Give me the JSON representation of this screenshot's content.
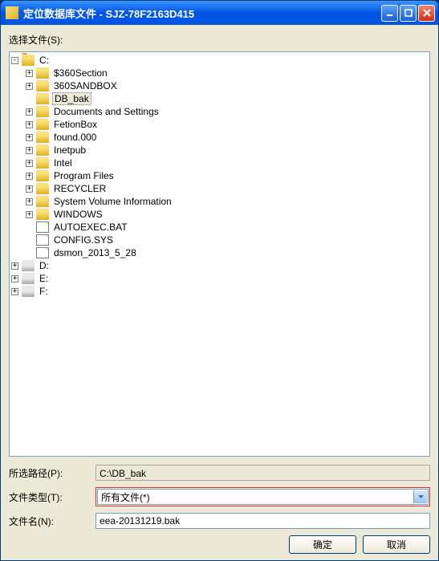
{
  "titlebar": {
    "title": "定位数据库文件 - SJZ-78F2163D415"
  },
  "labels": {
    "select_file": "选择文件(S):",
    "selected_path": "所选路径(P):",
    "file_type": "文件类型(T):",
    "file_name": "文件名(N):"
  },
  "tree": {
    "root_c": "C:",
    "items_c": [
      {
        "label": "$360Section",
        "exp": "plus",
        "icon": "folder"
      },
      {
        "label": "360SANDBOX",
        "exp": "plus",
        "icon": "folder"
      },
      {
        "label": "DB_bak",
        "exp": "none",
        "icon": "folder",
        "selected": true
      },
      {
        "label": "Documents and Settings",
        "exp": "plus",
        "icon": "folder"
      },
      {
        "label": "FetionBox",
        "exp": "plus",
        "icon": "folder"
      },
      {
        "label": "found.000",
        "exp": "plus",
        "icon": "folder"
      },
      {
        "label": "Inetpub",
        "exp": "plus",
        "icon": "folder"
      },
      {
        "label": "Intel",
        "exp": "plus",
        "icon": "folder"
      },
      {
        "label": "Program Files",
        "exp": "plus",
        "icon": "folder"
      },
      {
        "label": "RECYCLER",
        "exp": "plus",
        "icon": "folder"
      },
      {
        "label": "System Volume Information",
        "exp": "plus",
        "icon": "folder"
      },
      {
        "label": "WINDOWS",
        "exp": "plus",
        "icon": "folder"
      },
      {
        "label": "AUTOEXEC.BAT",
        "exp": "none",
        "icon": "file"
      },
      {
        "label": "CONFIG.SYS",
        "exp": "none",
        "icon": "file"
      },
      {
        "label": "dsmon_2013_5_28",
        "exp": "none",
        "icon": "file"
      }
    ],
    "root_d": "D:",
    "root_e": "E:",
    "root_f": "F:"
  },
  "values": {
    "selected_path": "C:\\DB_bak",
    "file_type": "所有文件(*)",
    "file_name": "eea-20131219.bak"
  },
  "buttons": {
    "ok": "确定",
    "cancel": "取消"
  }
}
